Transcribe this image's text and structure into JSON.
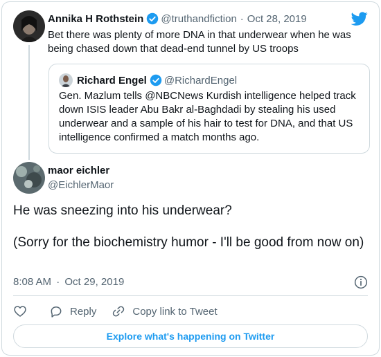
{
  "brand": {
    "twitter_blue": "#1d9bf0",
    "icon": "twitter-bird-icon"
  },
  "parent_tweet": {
    "author_name": "Annika H Rothstein",
    "author_handle": "@truthandfiction",
    "separator": "·",
    "date": "Oct 28, 2019",
    "text": "Bet there was plenty of more DNA in that underwear when he was being chased down that dead-end tunnel by US troops",
    "verified": true
  },
  "quoted_tweet": {
    "author_name": "Richard Engel",
    "author_handle": "@RichardEngel",
    "verified": true,
    "text": "Gen. Mazlum tells @NBCNews Kurdish intelligence helped track down ISIS leader Abu Bakr al-Baghdadi by stealing his used underwear and a sample of his hair to test for DNA, and that US intelligence confirmed a match months ago."
  },
  "main_tweet": {
    "author_name": "maor eichler",
    "author_handle": "@EichlerMaor",
    "text_line1": "He was sneezing into his underwear?",
    "text_line2": "(Sorry for the biochemistry humor - I'll be good from now on)",
    "time": "8:08 AM",
    "separator": "·",
    "date": "Oct 29, 2019"
  },
  "actions": {
    "like_icon": "heart-icon",
    "reply_label": "Reply",
    "copy_link_label": "Copy link to Tweet"
  },
  "explore_label": "Explore what's happening on Twitter"
}
